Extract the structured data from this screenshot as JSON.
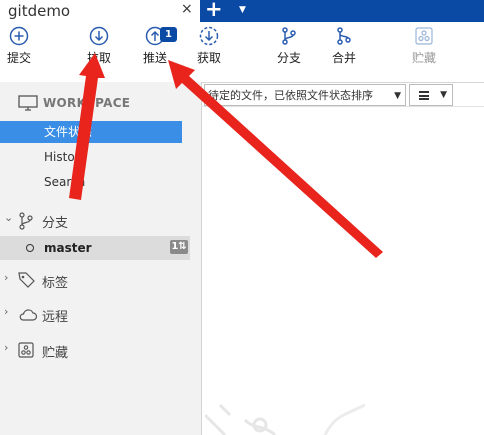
{
  "tab": {
    "title": "gitdemo",
    "close": "×"
  },
  "tabstrip": {
    "new_tab": "+",
    "menu": "▾"
  },
  "toolbar": {
    "commit": "提交",
    "pull": "拉取",
    "push": "推送",
    "push_badge": "1",
    "fetch": "获取",
    "branch": "分支",
    "merge": "合并",
    "stash": "贮藏"
  },
  "sidebar": {
    "workspace": "WORKSPACE",
    "items": [
      "文件状态",
      "History",
      "Search"
    ],
    "branches_label": "分支",
    "branch_name": "master",
    "branch_badge": "1⇅",
    "tags": "标签",
    "remotes": "远程",
    "stashes": "贮藏"
  },
  "filter": {
    "combo_text": "待定的文件，已依照文件状态排序",
    "arrow": "⌄"
  },
  "colors": {
    "accent": "#0a4aa5",
    "selected": "#3a8ee6",
    "arrow": "#e8241c"
  }
}
